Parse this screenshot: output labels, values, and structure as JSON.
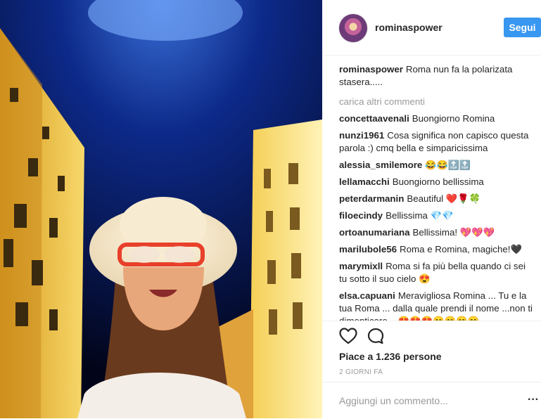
{
  "header": {
    "username": "rominaspower",
    "follow_label": "Segui"
  },
  "caption": {
    "user": "rominaspower",
    "text": "Roma nun fa la polarizata stasera....."
  },
  "load_more": "carica altri commenti",
  "comments": [
    {
      "user": "concettaavenali",
      "text": "Buongiorno Romina"
    },
    {
      "user": "nunzi1961",
      "text": "Cosa significa non capisco questa parola :) cmq bella e simparicissima"
    },
    {
      "user": "alessia_smilemore",
      "text": "😂😂🔝🔝"
    },
    {
      "user": "lellamacchi",
      "text": "Buongiorno bellissima"
    },
    {
      "user": "peterdarmanin",
      "text": "Beautiful ❤️🌹🍀"
    },
    {
      "user": "filoecindy",
      "text": "Bellissima 💎💎"
    },
    {
      "user": "ortoanumariana",
      "text": "Bellissima! 💖💖💖"
    },
    {
      "user": "marilubole56",
      "text": "Roma e Romina, magiche!🖤"
    },
    {
      "user": "marymixll",
      "text": "Roma si fa più bella quando ci sei tu sotto il suo cielo 😍"
    },
    {
      "user": "elsa.capuani",
      "text": "Meravigliosa Romina ... Tu e la tua Roma ... dalla quale prendi il nome ...non ti dimenticare... 😍😍😍😊😊😊😊"
    }
  ],
  "likes": "Piace a 1.236 persone",
  "timestamp": "2 GIORNI FA",
  "add_comment_placeholder": "Aggiungi un commento...",
  "icons": {
    "like": "heart-outline-icon",
    "comment": "comment-bubble-icon",
    "more": "more-options-icon"
  }
}
